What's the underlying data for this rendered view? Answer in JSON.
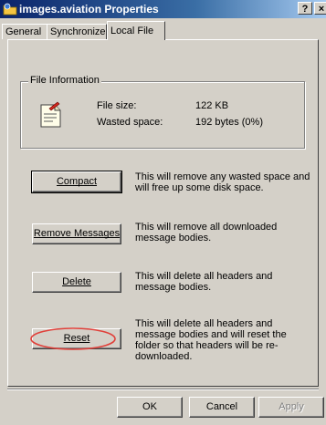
{
  "window": {
    "title": "images.aviation Properties",
    "help_label": "?",
    "close_label": "×"
  },
  "tabs": [
    {
      "label": "General",
      "active": false
    },
    {
      "label": "Synchronize",
      "active": false
    },
    {
      "label": "Local File",
      "active": true
    }
  ],
  "file_info": {
    "group_label": "File Information",
    "size_label": "File size:",
    "size_value": "122 KB",
    "wasted_label": "Wasted space:",
    "wasted_value": "192 bytes (0%)"
  },
  "actions": [
    {
      "button": "Compact",
      "description": "This will remove any wasted space and will free up some disk space."
    },
    {
      "button": "Remove Messages",
      "description": "This will remove all downloaded message bodies."
    },
    {
      "button": "Delete",
      "description": "This will delete all headers and message bodies."
    },
    {
      "button": "Reset",
      "description": "This will delete all headers and message bodies and will reset the folder so that headers will be re-downloaded."
    }
  ],
  "footer": {
    "ok_label": "OK",
    "cancel_label": "Cancel",
    "apply_label": "Apply"
  },
  "colors": {
    "dialog_face": "#d4d0c8",
    "title_start": "#0a246a",
    "title_end": "#a6caf0",
    "annotation": "#e0403a"
  },
  "icons": {
    "title": "outlook-express-folder-icon",
    "file_info": "document-properties-icon"
  }
}
